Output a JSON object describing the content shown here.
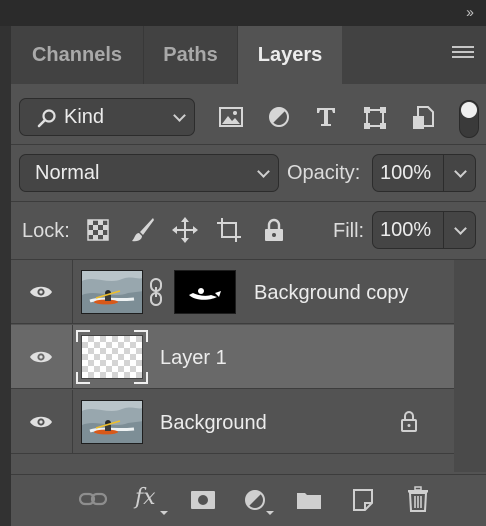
{
  "panel": {
    "collapse_glyph": "››",
    "tabs": [
      {
        "label": "Channels",
        "active": false
      },
      {
        "label": "Paths",
        "active": false
      },
      {
        "label": "Layers",
        "active": true
      }
    ]
  },
  "filter": {
    "kind_label": "Kind",
    "icons": [
      "image-filter-icon",
      "adjustment-filter-icon",
      "type-filter-icon",
      "shape-filter-icon",
      "smart-object-filter-icon",
      "filter-toggle-icon"
    ]
  },
  "blend": {
    "mode": "Normal",
    "opacity_label": "Opacity:",
    "opacity_value": "100%"
  },
  "lock": {
    "label": "Lock:",
    "icons": [
      "lock-transparent-pixels-icon",
      "lock-image-pixels-icon",
      "lock-position-icon",
      "lock-artboard-icon",
      "lock-all-icon"
    ],
    "fill_label": "Fill:",
    "fill_value": "100%"
  },
  "layers": [
    {
      "name": "Background copy",
      "visible": true,
      "has_mask": true,
      "selected": false,
      "locked": false
    },
    {
      "name": "Layer 1",
      "visible": true,
      "has_mask": false,
      "selected": true,
      "locked": false
    },
    {
      "name": "Background",
      "visible": true,
      "has_mask": false,
      "selected": false,
      "locked": true
    }
  ],
  "footer_icons": [
    "link-layers-icon",
    "layer-style-fx-icon",
    "add-mask-icon",
    "new-adjustment-layer-icon",
    "new-group-folder-icon",
    "new-layer-icon",
    "delete-layer-trash-icon"
  ],
  "footer": {
    "fx_label": "fx"
  },
  "colors": {
    "panel_bg": "#535353",
    "selected_row": "#696969",
    "tab_bar": "#424242",
    "field_bg": "#454545"
  }
}
